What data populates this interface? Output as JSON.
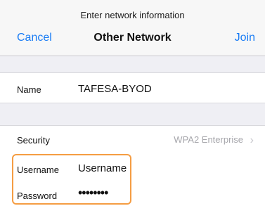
{
  "header": {
    "prompt": "Enter network information",
    "cancel_label": "Cancel",
    "title": "Other Network",
    "join_label": "Join"
  },
  "form": {
    "name_label": "Name",
    "name_value": "TAFESA-BYOD",
    "security_label": "Security",
    "security_value": "WPA2 Enterprise",
    "username_label": "Username",
    "username_value": "Username",
    "password_label": "Password",
    "password_value": "••••••••"
  },
  "colors": {
    "accent": "#1a7cf5",
    "highlight": "#f59d43",
    "background": "#efeff4",
    "muted": "#a7a7ac"
  },
  "icons": {
    "security_chevron": "chevron-right-icon"
  }
}
